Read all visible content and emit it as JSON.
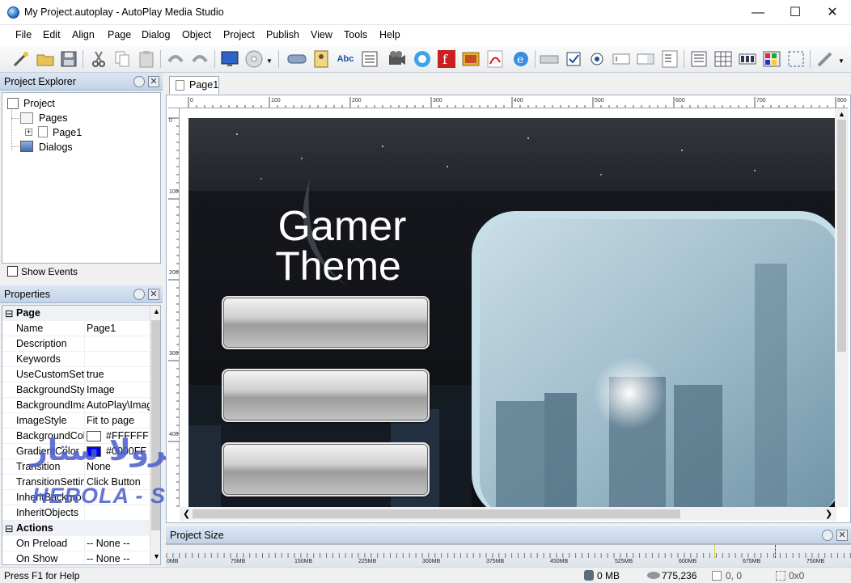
{
  "window": {
    "title": "My Project.autoplay - AutoPlay Media Studio"
  },
  "menu": [
    "File",
    "Edit",
    "Align",
    "Page",
    "Dialog",
    "Object",
    "Project",
    "Publish",
    "View",
    "Tools",
    "Help"
  ],
  "toolbar": {
    "text_object_label": "Abc"
  },
  "explorer": {
    "title": "Project Explorer",
    "tree": {
      "root": "Project",
      "pages": "Pages",
      "page1": "Page1",
      "dialogs": "Dialogs"
    },
    "show_events": "Show Events"
  },
  "properties": {
    "title": "Properties",
    "category_page": "Page",
    "rows": [
      {
        "name": "Name",
        "value": "Page1"
      },
      {
        "name": "Description",
        "value": ""
      },
      {
        "name": "Keywords",
        "value": ""
      },
      {
        "name": "UseCustomSett",
        "value": "true"
      },
      {
        "name": "BackgroundStyl",
        "value": "Image"
      },
      {
        "name": "BackgroundIma",
        "value": "AutoPlay\\Imag"
      },
      {
        "name": "ImageStyle",
        "value": "Fit to page"
      },
      {
        "name": "BackgroundCol",
        "value": "#FFFFFF",
        "swatch": "#ffffff"
      },
      {
        "name": "GradientColor",
        "value": "#0000FF",
        "swatch": "#0000ff"
      },
      {
        "name": "Transition",
        "value": "None"
      },
      {
        "name": "TransitionSettin",
        "value": "Click Button"
      },
      {
        "name": "InheritBackgro",
        "value": ""
      },
      {
        "name": "InheritObjects",
        "value": ""
      }
    ],
    "category_actions": "Actions",
    "actions": [
      {
        "name": "On Preload",
        "value": "-- None --"
      },
      {
        "name": "On Show",
        "value": "-- None --"
      }
    ]
  },
  "document_tab": "Page1",
  "ruler": {
    "h": [
      "0",
      "100",
      "200",
      "300",
      "400",
      "500",
      "600",
      "700",
      "800"
    ],
    "v": [
      "0",
      "100",
      "200",
      "300",
      "400"
    ]
  },
  "canvas": {
    "heading_line1": "Gamer",
    "heading_line2": "Theme"
  },
  "watermark": {
    "arabic": "منتديات هرولا ستار",
    "latin": "HEROLA - STAR FORUMS"
  },
  "project_size": {
    "title": "Project Size",
    "marks": [
      "0MB",
      "75MB",
      "150MB",
      "225MB",
      "300MB",
      "375MB",
      "450MB",
      "525MB",
      "600MB",
      "675MB",
      "750MB"
    ]
  },
  "status": {
    "help": "Press F1 for Help",
    "memory": "0 MB",
    "size": "775,236",
    "position": "0, 0",
    "dimensions": "0x0"
  },
  "colors": {
    "accent": "#2a74c9",
    "panel_header": "#c3d3e6"
  }
}
